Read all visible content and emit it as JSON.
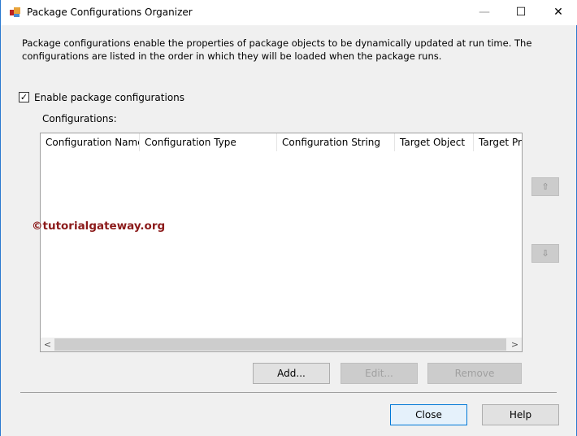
{
  "window": {
    "title": "Package Configurations Organizer",
    "minimize": "—",
    "maximize": "☐",
    "close": "✕"
  },
  "description": "Package configurations enable the properties of package objects to be dynamically updated at run time. The configurations are listed in the order in which they will be loaded when the package runs.",
  "enable_checkbox": {
    "label": "Enable package configurations",
    "checked": true,
    "mark": "✓"
  },
  "configurations_label": "Configurations:",
  "columns": [
    "Configuration Name",
    "Configuration Type",
    "Configuration String",
    "Target Object",
    "Target Property"
  ],
  "scroll": {
    "left": "<",
    "right": ">"
  },
  "move_up": "⇧",
  "move_down": "⇩",
  "buttons": {
    "add": "Add...",
    "edit": "Edit...",
    "remove": "Remove",
    "close": "Close",
    "help": "Help"
  },
  "watermark": "©tutorialgateway.org"
}
